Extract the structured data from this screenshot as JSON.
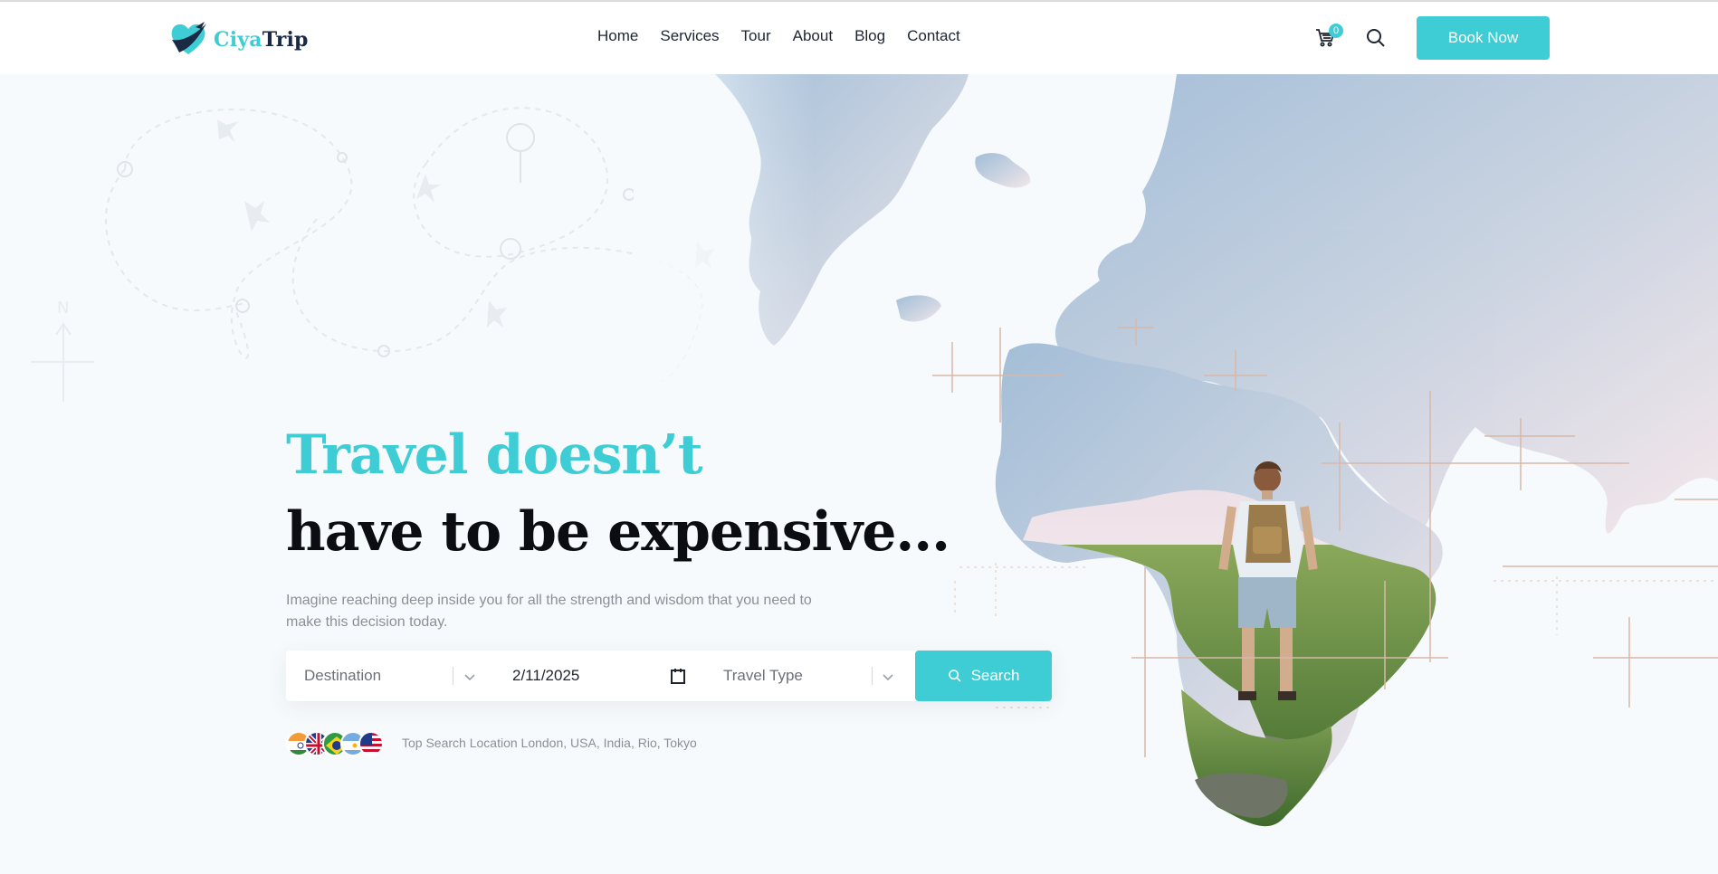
{
  "brand": {
    "name_part1": "Ciya",
    "name_part2": "Trip",
    "accent_color": "#3ecdd4",
    "dark_color": "#1a2a44"
  },
  "nav": {
    "items": [
      "Home",
      "Services",
      "Tour",
      "About",
      "Blog",
      "Contact"
    ]
  },
  "header": {
    "cart_count": "0",
    "cart_icon": "cart-icon",
    "search_icon": "search-icon",
    "book_label": "Book Now"
  },
  "hero": {
    "title_line1": "Travel doesn’t",
    "title_line2": "have to be expensive...",
    "subtitle": "Imagine reaching deep inside you for all the strength and wisdom that you need to make this decision today."
  },
  "search": {
    "destination_placeholder": "Destination",
    "date_value": "2/11/2025",
    "travel_type_placeholder": "Travel Type",
    "button_label": "Search"
  },
  "top_search": {
    "text": "Top Search Location London, USA, India, Rio, Tokyo",
    "flags": [
      "India",
      "United Kingdom",
      "Brazil",
      "Argentina",
      "USA"
    ]
  }
}
